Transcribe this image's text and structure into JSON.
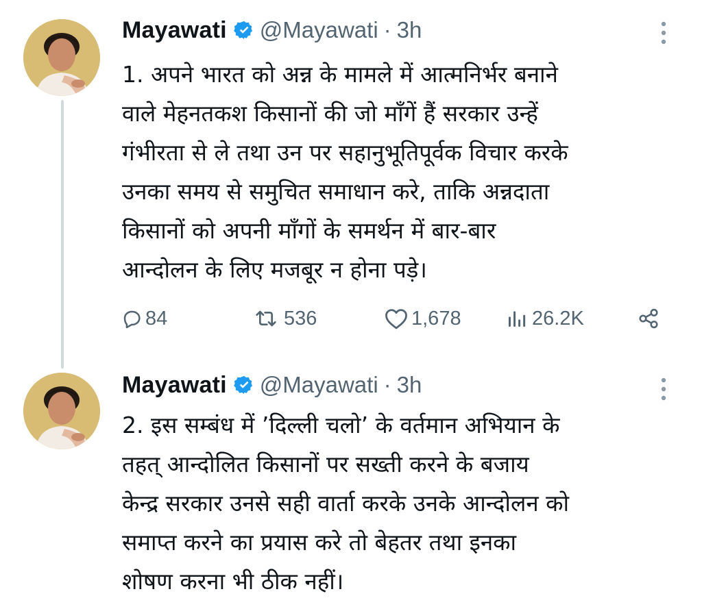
{
  "tweets": [
    {
      "display_name": "Mayawati",
      "handle": "@Mayawati",
      "separator": "·",
      "time": "3h",
      "text": "1. अपने भारत को अन्न के मामले में आत्मनिर्भर बनाने\nवाले मेहनतकश किसानों की जो माँगें हैं सरकार उन्हें\nगंभीरता से ले तथा उन पर सहानुभूतिपूर्वक विचार करके\nउनका समय से समुचित समाधान करे, ताकि अन्नदाता\nकिसानों को अपनी माँगों के समर्थन में बार-बार\nआन्दोलन के लिए मजबूर न होना पड़े।",
      "stats": {
        "replies": "84",
        "reposts": "536",
        "likes": "1,678",
        "views": "26.2K"
      }
    },
    {
      "display_name": "Mayawati",
      "handle": "@Mayawati",
      "separator": "·",
      "time": "3h",
      "text": "2. इस सम्बंध में ’दिल्ली चलो’ के वर्तमान अभियान के\nतहत् आन्दोलित किसानों पर सख्ती करने के बजाय\nकेन्द्र सरकार उनसे सही वार्ता करके उनके आन्दोलन को\nसमाप्त करने का प्रयास करे तो बेहतर तथा इनका\nशोषण करना भी ठीक नहीं।"
    }
  ],
  "icons": {
    "verified": "verified-badge-icon",
    "more": "more-vertical-icon",
    "reply": "reply-icon",
    "repost": "repost-icon",
    "like": "heart-icon",
    "views": "views-icon",
    "share": "share-icon"
  },
  "colors": {
    "text_primary": "#0f1419",
    "text_secondary": "#536471",
    "verified_blue": "#1d9bf0",
    "thread_line": "#cfd9de"
  }
}
